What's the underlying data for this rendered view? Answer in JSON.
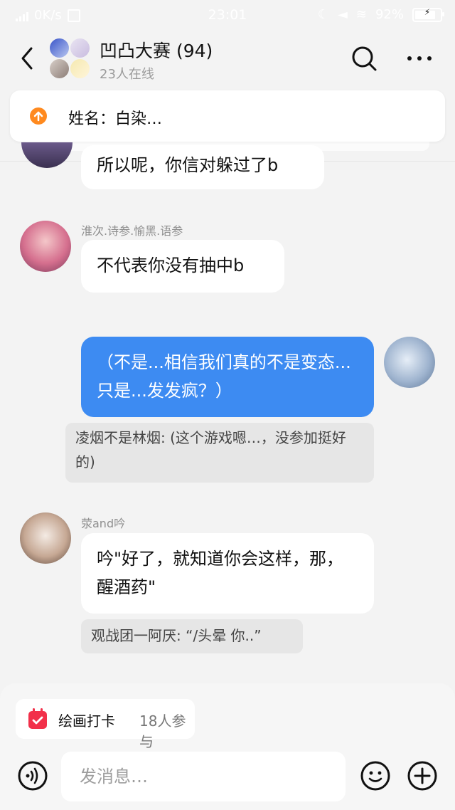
{
  "status_bar": {
    "network_speed": "0K/s",
    "time": "23:01",
    "battery": "92%",
    "battery_level": 0.92
  },
  "header": {
    "title": "凹凸大赛 (94)",
    "subtitle": "23人在线"
  },
  "pinned": {
    "text": "姓名：白染…"
  },
  "messages": [
    {
      "sender": "",
      "text": "所以呢，你信对躲过了b",
      "outgoing": false
    },
    {
      "sender": "淮次.诗参.愉黑.语参",
      "text": "不代表你没有抽中b",
      "outgoing": false
    },
    {
      "sender": "",
      "text": "（不是...相信我们真的不是变态...只是...发发疯？）",
      "outgoing": true,
      "quote": "凌烟不是林烟: (这个游戏嗯…，没参加挺好的)"
    },
    {
      "sender": "荥and吟",
      "text": "吟\"好了，就知道你会这样，那，醒酒药\"",
      "outgoing": false,
      "quote": "观战团一阿厌: “/头晕  你..”"
    }
  ],
  "bottom": {
    "checkin_label": "绘画打卡",
    "checkin_count": "18人参与",
    "input_placeholder": "发消息…"
  },
  "icons": {
    "back": "back-arrow-icon",
    "search": "search-icon",
    "more": "more-dots-icon",
    "pin": "pin-up-icon",
    "calendar": "calendar-icon",
    "voice": "voice-icon",
    "emoji": "emoji-icon",
    "plus": "plus-icon"
  },
  "colors": {
    "accent_blue": "#3d8bf2",
    "pin_orange": "#ff8a1f",
    "calendar_red": "#f2304a"
  }
}
